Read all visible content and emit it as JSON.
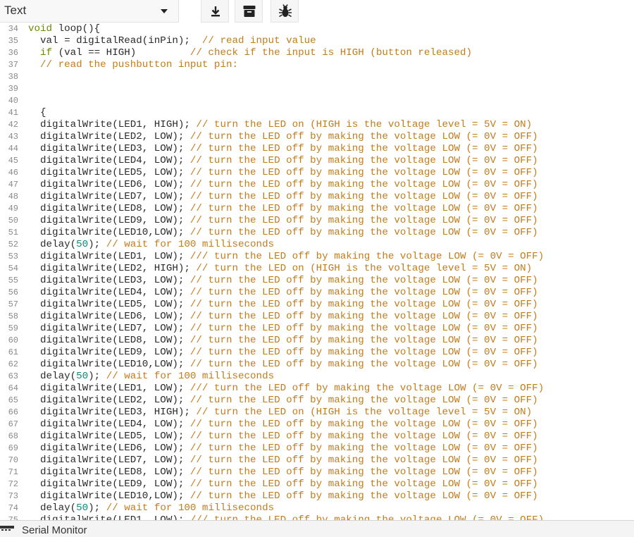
{
  "toolbar": {
    "mode": "Text",
    "buttons": [
      {
        "name": "download-icon"
      },
      {
        "name": "archive-icon"
      },
      {
        "name": "bug-icon"
      }
    ]
  },
  "colors": {
    "code": "#2a2a2a",
    "keyword": "#6a8a00",
    "comment": "#c27c1c",
    "number": "#0d8a7a",
    "line_number": "#8a8a8a"
  },
  "editor": {
    "lines": [
      {
        "n": "34",
        "text": "void loop(){"
      },
      {
        "n": "35",
        "text": "  val = digitalRead(inPin);  // read input value"
      },
      {
        "n": "36",
        "text": "  if (val == HIGH)         // check if the input is HIGH (button released)"
      },
      {
        "n": "37",
        "text": "  // read the pushbutton input pin:"
      },
      {
        "n": "38",
        "text": ""
      },
      {
        "n": "39",
        "text": ""
      },
      {
        "n": "40",
        "text": ""
      },
      {
        "n": "41",
        "text": "  {"
      },
      {
        "n": "42",
        "text": "  digitalWrite(LED1, HIGH); // turn the LED on (HIGH is the voltage level = 5V = ON)"
      },
      {
        "n": "43",
        "text": "  digitalWrite(LED2, LOW); // turn the LED off by making the voltage LOW (= 0V = OFF)"
      },
      {
        "n": "44",
        "text": "  digitalWrite(LED3, LOW); // turn the LED off by making the voltage LOW (= 0V = OFF)"
      },
      {
        "n": "45",
        "text": "  digitalWrite(LED4, LOW); // turn the LED off by making the voltage LOW (= 0V = OFF)"
      },
      {
        "n": "46",
        "text": "  digitalWrite(LED5, LOW); // turn the LED off by making the voltage LOW (= 0V = OFF)"
      },
      {
        "n": "47",
        "text": "  digitalWrite(LED6, LOW); // turn the LED off by making the voltage LOW (= 0V = OFF)"
      },
      {
        "n": "48",
        "text": "  digitalWrite(LED7, LOW); // turn the LED off by making the voltage LOW (= 0V = OFF)"
      },
      {
        "n": "49",
        "text": "  digitalWrite(LED8, LOW); // turn the LED off by making the voltage LOW (= 0V = OFF)"
      },
      {
        "n": "50",
        "text": "  digitalWrite(LED9, LOW); // turn the LED off by making the voltage LOW (= 0V = OFF)"
      },
      {
        "n": "51",
        "text": "  digitalWrite(LED10,LOW); // turn the LED off by making the voltage LOW (= 0V = OFF)"
      },
      {
        "n": "52",
        "text": "  delay(50); // wait for 100 milliseconds"
      },
      {
        "n": "53",
        "text": "  digitalWrite(LED1, LOW); /// turn the LED off by making the voltage LOW (= 0V = OFF)"
      },
      {
        "n": "54",
        "text": "  digitalWrite(LED2, HIGH); // turn the LED on (HIGH is the voltage level = 5V = ON)"
      },
      {
        "n": "55",
        "text": "  digitalWrite(LED3, LOW); // turn the LED off by making the voltage LOW (= 0V = OFF)"
      },
      {
        "n": "56",
        "text": "  digitalWrite(LED4, LOW); // turn the LED off by making the voltage LOW (= 0V = OFF)"
      },
      {
        "n": "57",
        "text": "  digitalWrite(LED5, LOW); // turn the LED off by making the voltage LOW (= 0V = OFF)"
      },
      {
        "n": "58",
        "text": "  digitalWrite(LED6, LOW); // turn the LED off by making the voltage LOW (= 0V = OFF)"
      },
      {
        "n": "59",
        "text": "  digitalWrite(LED7, LOW); // turn the LED off by making the voltage LOW (= 0V = OFF)"
      },
      {
        "n": "60",
        "text": "  digitalWrite(LED8, LOW); // turn the LED off by making the voltage LOW (= 0V = OFF)"
      },
      {
        "n": "61",
        "text": "  digitalWrite(LED9, LOW); // turn the LED off by making the voltage LOW (= 0V = OFF)"
      },
      {
        "n": "62",
        "text": "  digitalWrite(LED10,LOW); // turn the LED off by making the voltage LOW (= 0V = OFF)"
      },
      {
        "n": "63",
        "text": "  delay(50); // wait for 100 milliseconds"
      },
      {
        "n": "64",
        "text": "  digitalWrite(LED1, LOW); /// turn the LED off by making the voltage LOW (= 0V = OFF)"
      },
      {
        "n": "65",
        "text": "  digitalWrite(LED2, LOW); // turn the LED off by making the voltage LOW (= 0V = OFF)"
      },
      {
        "n": "66",
        "text": "  digitalWrite(LED3, HIGH); // turn the LED on (HIGH is the voltage level = 5V = ON)"
      },
      {
        "n": "67",
        "text": "  digitalWrite(LED4, LOW); // turn the LED off by making the voltage LOW (= 0V = OFF)"
      },
      {
        "n": "68",
        "text": "  digitalWrite(LED5, LOW); // turn the LED off by making the voltage LOW (= 0V = OFF)"
      },
      {
        "n": "69",
        "text": "  digitalWrite(LED6, LOW); // turn the LED off by making the voltage LOW (= 0V = OFF)"
      },
      {
        "n": "70",
        "text": "  digitalWrite(LED7, LOW); // turn the LED off by making the voltage LOW (= 0V = OFF)"
      },
      {
        "n": "71",
        "text": "  digitalWrite(LED8, LOW); // turn the LED off by making the voltage LOW (= 0V = OFF)"
      },
      {
        "n": "72",
        "text": "  digitalWrite(LED9, LOW); // turn the LED off by making the voltage LOW (= 0V = OFF)"
      },
      {
        "n": "73",
        "text": "  digitalWrite(LED10,LOW); // turn the LED off by making the voltage LOW (= 0V = OFF)"
      },
      {
        "n": "74",
        "text": "  delay(50); // wait for 100 milliseconds"
      },
      {
        "n": "75",
        "text": "  digitalWrite(LED1, LOW); /// turn the LED off by making the voltage LOW (= 0V = OFF)"
      }
    ]
  },
  "status": {
    "serial_monitor_label": "Serial Monitor"
  }
}
